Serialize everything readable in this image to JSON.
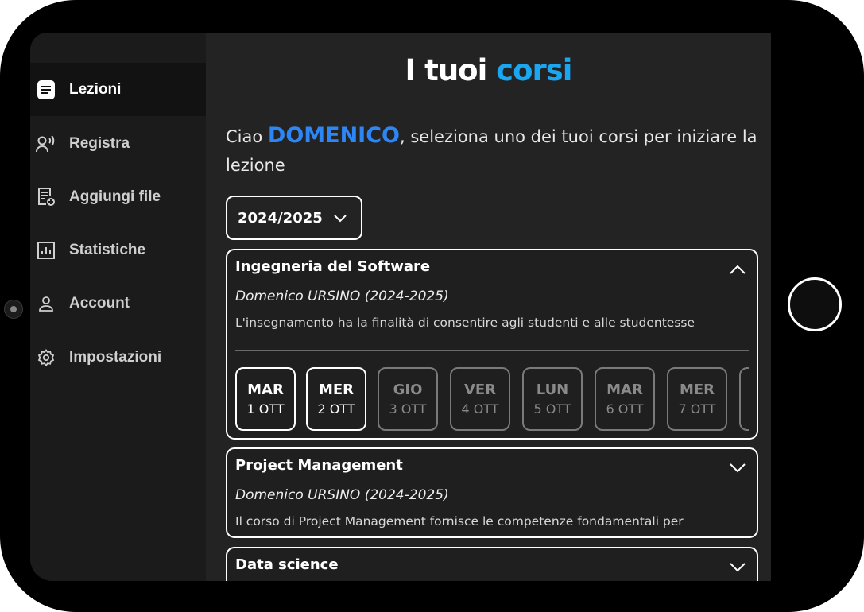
{
  "sidebar": {
    "items": [
      {
        "label": "Lezioni",
        "icon": "document-icon",
        "active": true
      },
      {
        "label": "Registra",
        "icon": "voice-icon",
        "active": false
      },
      {
        "label": "Aggiungi file",
        "icon": "add-file-icon",
        "active": false
      },
      {
        "label": "Statistiche",
        "icon": "chart-icon",
        "active": false
      },
      {
        "label": "Account",
        "icon": "user-icon",
        "active": false
      },
      {
        "label": "Impostazioni",
        "icon": "gear-icon",
        "active": false
      }
    ]
  },
  "header": {
    "title_prefix": "I tuoi",
    "title_accent": "corsi",
    "accent_color": "#1aa6f0"
  },
  "greeting": {
    "prefix": "Ciao",
    "name": "DOMENICO",
    "suffix": ", seleziona uno dei tuoi corsi per iniziare la lezione",
    "name_color": "#2e86f5"
  },
  "year_select": {
    "value": "2024/2025"
  },
  "courses": [
    {
      "title": "Ingegneria del Software",
      "professor": "Domenico URSINO (2024-2025)",
      "description": "L'insegnamento ha la finalità di consentire agli studenti e alle studentesse",
      "expanded": true,
      "lessons": [
        {
          "weekday": "MAR",
          "date": "1 OTT",
          "active": true
        },
        {
          "weekday": "MER",
          "date": "2 OTT",
          "active": true
        },
        {
          "weekday": "GIO",
          "date": "3 OTT",
          "active": false
        },
        {
          "weekday": "VER",
          "date": "4 OTT",
          "active": false
        },
        {
          "weekday": "LUN",
          "date": "5 OTT",
          "active": false
        },
        {
          "weekday": "MAR",
          "date": "6 OTT",
          "active": false
        },
        {
          "weekday": "MER",
          "date": "7 OTT",
          "active": false
        }
      ]
    },
    {
      "title": "Project Management",
      "professor": "Domenico URSINO (2024-2025)",
      "description": "Il corso di Project Management fornisce le competenze fondamentali per",
      "expanded": false
    },
    {
      "title": "Data science",
      "expanded": false
    }
  ]
}
